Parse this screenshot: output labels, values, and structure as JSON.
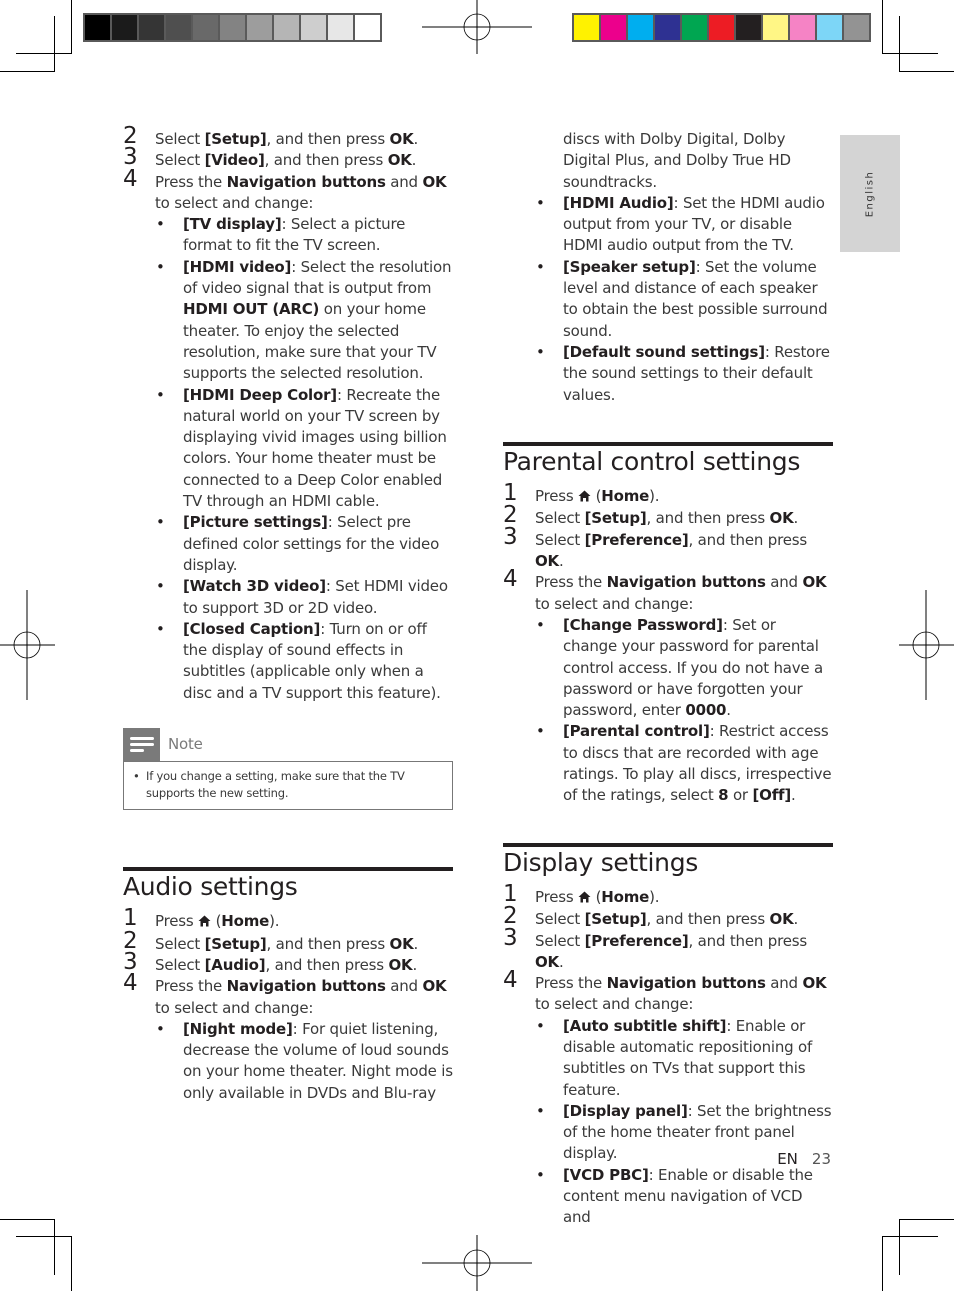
{
  "print_marks": {
    "grayscale_swatches": [
      "#000000",
      "#1b1b1b",
      "#353535",
      "#4f4f4f",
      "#696969",
      "#838383",
      "#9d9d9d",
      "#b5b5b5",
      "#cecece",
      "#e7e7e7",
      "#ffffff"
    ],
    "color_swatches": [
      "#fff200",
      "#ec008c",
      "#00aeef",
      "#2e3192",
      "#00a651",
      "#ed1c24",
      "#231f20",
      "#fff685",
      "#f583c5",
      "#7dd6f7",
      "#939393"
    ]
  },
  "side_tab": {
    "label": "English"
  },
  "left_column": {
    "video_steps": [
      {
        "num": "2",
        "parts": [
          [
            "Select ",
            0
          ],
          [
            "[Setup]",
            1
          ],
          [
            ", and then press ",
            0
          ],
          [
            "OK",
            1
          ],
          [
            ".",
            0
          ]
        ]
      },
      {
        "num": "3",
        "parts": [
          [
            "Select ",
            0
          ],
          [
            "[Video]",
            1
          ],
          [
            ", and then press ",
            0
          ],
          [
            "OK",
            1
          ],
          [
            ".",
            0
          ]
        ]
      },
      {
        "num": "4",
        "parts": [
          [
            "Press the ",
            0
          ],
          [
            "Navigation buttons",
            1
          ],
          [
            " and ",
            0
          ],
          [
            "OK",
            1
          ],
          [
            " to select and change:",
            0
          ]
        ]
      }
    ],
    "video_options": [
      {
        "name": "[TV display]",
        "desc": ": Select a picture format to fit the TV screen."
      },
      {
        "name": "[HDMI video]",
        "desc": ": Select the resolution of video signal that is output from ",
        "bold2": "HDMI OUT (ARC)",
        "desc2": " on your home theater. To enjoy the selected resolution, make sure that your TV supports the selected resolution."
      },
      {
        "name": "[HDMI Deep Color]",
        "desc": ": Recreate the natural world on your TV screen by displaying vivid images using billion colors. Your home theater must be connected to a Deep Color enabled TV through an HDMI cable."
      },
      {
        "name": "[Picture settings]",
        "desc": ": Select pre defined color settings for the video display."
      },
      {
        "name": "[Watch 3D video]",
        "desc": ": Set HDMI video to support 3D or 2D video."
      },
      {
        "name": "[Closed Caption]",
        "desc": ": Turn on or off the display of sound effects in subtitles (applicable only when a disc and a TV support this feature)."
      }
    ],
    "note": {
      "label": "Note",
      "text": "If you change a setting, make sure that the TV supports the new setting."
    },
    "audio_section": {
      "title": "Audio settings",
      "steps": [
        {
          "num": "1",
          "home": true,
          "parts": [
            [
              "Press ",
              0
            ],
            [
              "HOME_ICON",
              2
            ],
            [
              " (",
              0
            ],
            [
              "Home",
              1
            ],
            [
              ").",
              0
            ]
          ]
        },
        {
          "num": "2",
          "parts": [
            [
              "Select ",
              0
            ],
            [
              "[Setup]",
              1
            ],
            [
              ", and then press ",
              0
            ],
            [
              "OK",
              1
            ],
            [
              ".",
              0
            ]
          ]
        },
        {
          "num": "3",
          "parts": [
            [
              "Select ",
              0
            ],
            [
              "[Audio]",
              1
            ],
            [
              ", and then press ",
              0
            ],
            [
              "OK",
              1
            ],
            [
              ".",
              0
            ]
          ]
        },
        {
          "num": "4",
          "parts": [
            [
              "Press the ",
              0
            ],
            [
              "Navigation buttons",
              1
            ],
            [
              " and ",
              0
            ],
            [
              "OK",
              1
            ],
            [
              " to select and change:",
              0
            ]
          ]
        }
      ],
      "options": [
        {
          "name": "[Night mode]",
          "desc": ": For quiet listening, decrease the volume of loud sounds on your home theater. Night mode is only available in DVDs and Blu-ray"
        }
      ]
    }
  },
  "right_column": {
    "audio_continued_text": "discs with Dolby Digital, Dolby Digital Plus, and Dolby True HD soundtracks.",
    "audio_options": [
      {
        "name": "[HDMI Audio]",
        "desc": ": Set the HDMI audio output from your TV, or disable HDMI audio output from the TV."
      },
      {
        "name": "[Speaker setup]",
        "desc": ": Set the volume level and distance of each speaker to obtain the best possible surround sound."
      },
      {
        "name": "[Default sound settings]",
        "desc": ": Restore the sound settings to their default values."
      }
    ],
    "parental_section": {
      "title": "Parental control settings",
      "steps": [
        {
          "num": "1",
          "parts": [
            [
              "Press ",
              0
            ],
            [
              "HOME_ICON",
              2
            ],
            [
              " (",
              0
            ],
            [
              "Home",
              1
            ],
            [
              ").",
              0
            ]
          ]
        },
        {
          "num": "2",
          "parts": [
            [
              "Select ",
              0
            ],
            [
              "[Setup]",
              1
            ],
            [
              ", and then press ",
              0
            ],
            [
              "OK",
              1
            ],
            [
              ".",
              0
            ]
          ]
        },
        {
          "num": "3",
          "parts": [
            [
              "Select ",
              0
            ],
            [
              "[Preference]",
              1
            ],
            [
              ", and then press ",
              0
            ],
            [
              "OK",
              1
            ],
            [
              ".",
              0
            ]
          ]
        },
        {
          "num": "4",
          "parts": [
            [
              "Press the ",
              0
            ],
            [
              "Navigation buttons",
              1
            ],
            [
              " and ",
              0
            ],
            [
              "OK",
              1
            ],
            [
              " to select and change:",
              0
            ]
          ]
        }
      ],
      "options": [
        {
          "name": "[Change Password]",
          "desc": ": Set or change your password for parental control access. If you do not have a password or have forgotten your password, enter ",
          "bold2": "0000",
          "desc2": "."
        },
        {
          "name": "[Parental control]",
          "desc": ": Restrict access to discs that are recorded with age ratings. To play all discs, irrespective of the ratings, select ",
          "bold2": "8",
          "desc2": " or ",
          "bold3": "[Off]",
          "desc3": "."
        }
      ]
    },
    "display_section": {
      "title": "Display settings",
      "steps": [
        {
          "num": "1",
          "parts": [
            [
              "Press ",
              0
            ],
            [
              "HOME_ICON",
              2
            ],
            [
              " (",
              0
            ],
            [
              "Home",
              1
            ],
            [
              ").",
              0
            ]
          ]
        },
        {
          "num": "2",
          "parts": [
            [
              "Select ",
              0
            ],
            [
              "[Setup]",
              1
            ],
            [
              ", and then press ",
              0
            ],
            [
              "OK",
              1
            ],
            [
              ".",
              0
            ]
          ]
        },
        {
          "num": "3",
          "parts": [
            [
              "Select ",
              0
            ],
            [
              "[Preference]",
              1
            ],
            [
              ", and then press ",
              0
            ],
            [
              "OK",
              1
            ],
            [
              ".",
              0
            ]
          ]
        },
        {
          "num": "4",
          "parts": [
            [
              "Press the ",
              0
            ],
            [
              "Navigation buttons",
              1
            ],
            [
              " and ",
              0
            ],
            [
              "OK",
              1
            ],
            [
              " to select and change:",
              0
            ]
          ]
        }
      ],
      "options": [
        {
          "name": "[Auto subtitle shift]",
          "desc": ": Enable or disable automatic repositioning of subtitles on TVs that support this feature."
        },
        {
          "name": "[Display panel]",
          "desc": ": Set the brightness of the home theater front panel display."
        },
        {
          "name": "[VCD PBC]",
          "desc": ": Enable or disable the content menu navigation of VCD and"
        }
      ]
    }
  },
  "footer": {
    "lang": "EN",
    "page_number": "23"
  }
}
